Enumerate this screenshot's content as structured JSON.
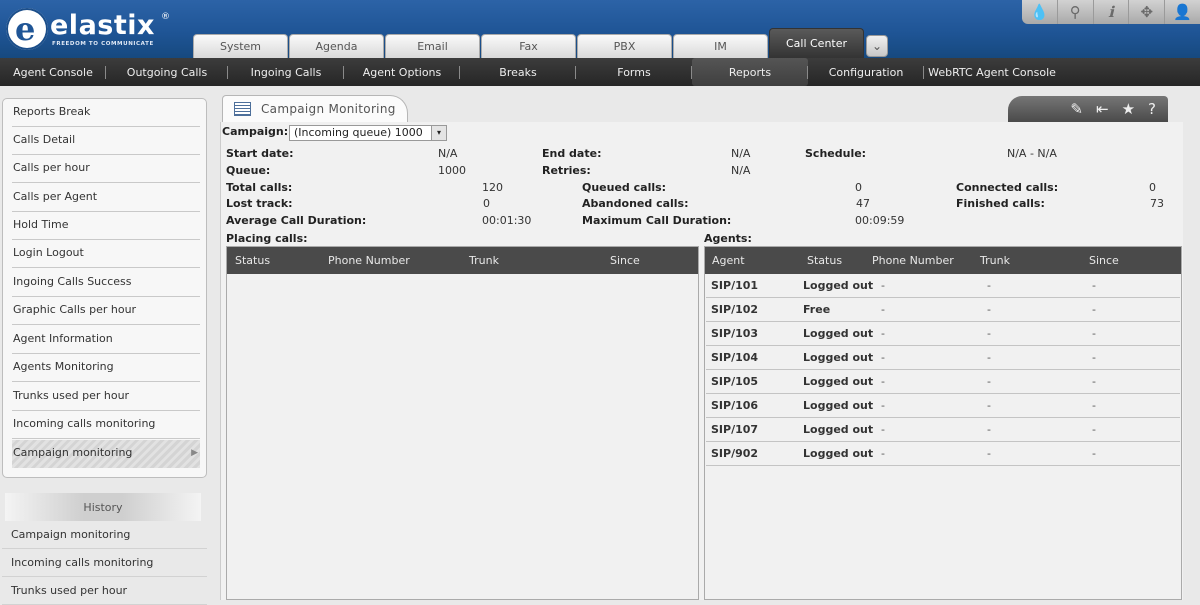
{
  "brand": {
    "name": "elastix",
    "tagline": "FREEDOM TO COMMUNICATE",
    "reg": "®",
    "accent_color": "#1f5596"
  },
  "top_tools": [
    {
      "name": "drop-icon",
      "glyph": "💧"
    },
    {
      "name": "search-icon",
      "glyph": "⚲"
    },
    {
      "name": "info-icon",
      "glyph": "ℹ"
    },
    {
      "name": "puzzle-icon",
      "glyph": "✥"
    },
    {
      "name": "user-icon",
      "glyph": "👤"
    }
  ],
  "tabs": [
    {
      "label": "System",
      "active": false
    },
    {
      "label": "Agenda",
      "active": false
    },
    {
      "label": "Email",
      "active": false
    },
    {
      "label": "Fax",
      "active": false
    },
    {
      "label": "PBX",
      "active": false
    },
    {
      "label": "IM",
      "active": false
    },
    {
      "label": "Call Center",
      "active": true
    }
  ],
  "tab_more_glyph": "⌄",
  "subnav": [
    {
      "label": "Agent Console",
      "width": 106
    },
    {
      "label": "Outgoing Calls",
      "width": 122
    },
    {
      "label": "Ingoing Calls",
      "width": 116
    },
    {
      "label": "Agent Options",
      "width": 116
    },
    {
      "label": "Breaks",
      "width": 116
    },
    {
      "label": "Forms",
      "width": 116
    },
    {
      "label": "Reports",
      "width": 116,
      "active": true
    },
    {
      "label": "Configuration",
      "width": 116
    },
    {
      "label": "WebRTC Agent Console",
      "width": 136,
      "last": true
    }
  ],
  "left_menu": [
    {
      "label": "Reports Break"
    },
    {
      "label": "Calls Detail"
    },
    {
      "label": "Calls per hour"
    },
    {
      "label": "Calls per Agent"
    },
    {
      "label": "Hold Time"
    },
    {
      "label": "Login Logout"
    },
    {
      "label": "Ingoing Calls Success"
    },
    {
      "label": "Graphic Calls per hour"
    },
    {
      "label": "Agent Information"
    },
    {
      "label": "Agents Monitoring"
    },
    {
      "label": "Trunks used per hour"
    },
    {
      "label": "Incoming calls monitoring"
    },
    {
      "label": "Campaign monitoring",
      "active": true
    }
  ],
  "left_menu_active_arrow": "▶",
  "history": {
    "title": "History",
    "items": [
      "Campaign monitoring",
      "Incoming calls monitoring",
      "Trunks used per hour"
    ]
  },
  "main": {
    "title": "Campaign Monitoring",
    "tools": [
      {
        "name": "edit-icon",
        "glyph": "✎"
      },
      {
        "name": "collapse-icon",
        "glyph": "⇤"
      },
      {
        "name": "star-icon",
        "glyph": "★"
      },
      {
        "name": "help-icon",
        "glyph": "?"
      }
    ]
  },
  "campaign": {
    "label": "Campaign:",
    "selected": "(Incoming queue) 1000",
    "arrow": "▾"
  },
  "info": {
    "start_date_label": "Start date:",
    "start_date": "N/A",
    "end_date_label": "End date:",
    "end_date": "N/A",
    "schedule_label": "Schedule:",
    "schedule": "N/A - N/A",
    "queue_label": "Queue:",
    "queue": "1000",
    "retries_label": "Retries:",
    "retries": "N/A"
  },
  "stats": {
    "total_calls_label": "Total calls:",
    "total_calls": "120",
    "queued_calls_label": "Queued calls:",
    "queued_calls": "0",
    "connected_calls_label": "Connected calls:",
    "connected_calls": "0",
    "lost_track_label": "Lost track:",
    "lost_track": "0",
    "abandoned_calls_label": "Abandoned calls:",
    "abandoned_calls": "47",
    "finished_calls_label": "Finished calls:",
    "finished_calls": "73",
    "avg_duration_label": "Average Call Duration:",
    "avg_duration": "00:01:30",
    "max_duration_label": "Maximum Call Duration:",
    "max_duration": "00:09:59"
  },
  "placing_calls": {
    "title": "Placing calls:",
    "headers": [
      "Status",
      "Phone Number",
      "Trunk",
      "Since"
    ]
  },
  "agents": {
    "title": "Agents:",
    "headers": [
      "Agent",
      "Status",
      "Phone Number",
      "Trunk",
      "Since"
    ],
    "rows": [
      {
        "agent": "SIP/101",
        "status": "Logged out",
        "phone": "-",
        "trunk": "-",
        "since": "-"
      },
      {
        "agent": "SIP/102",
        "status": "Free",
        "phone": "-",
        "trunk": "-",
        "since": "-"
      },
      {
        "agent": "SIP/103",
        "status": "Logged out",
        "phone": "-",
        "trunk": "-",
        "since": "-"
      },
      {
        "agent": "SIP/104",
        "status": "Logged out",
        "phone": "-",
        "trunk": "-",
        "since": "-"
      },
      {
        "agent": "SIP/105",
        "status": "Logged out",
        "phone": "-",
        "trunk": "-",
        "since": "-"
      },
      {
        "agent": "SIP/106",
        "status": "Logged out",
        "phone": "-",
        "trunk": "-",
        "since": "-"
      },
      {
        "agent": "SIP/107",
        "status": "Logged out",
        "phone": "-",
        "trunk": "-",
        "since": "-"
      },
      {
        "agent": "SIP/902",
        "status": "Logged out",
        "phone": "-",
        "trunk": "-",
        "since": "-"
      }
    ]
  }
}
